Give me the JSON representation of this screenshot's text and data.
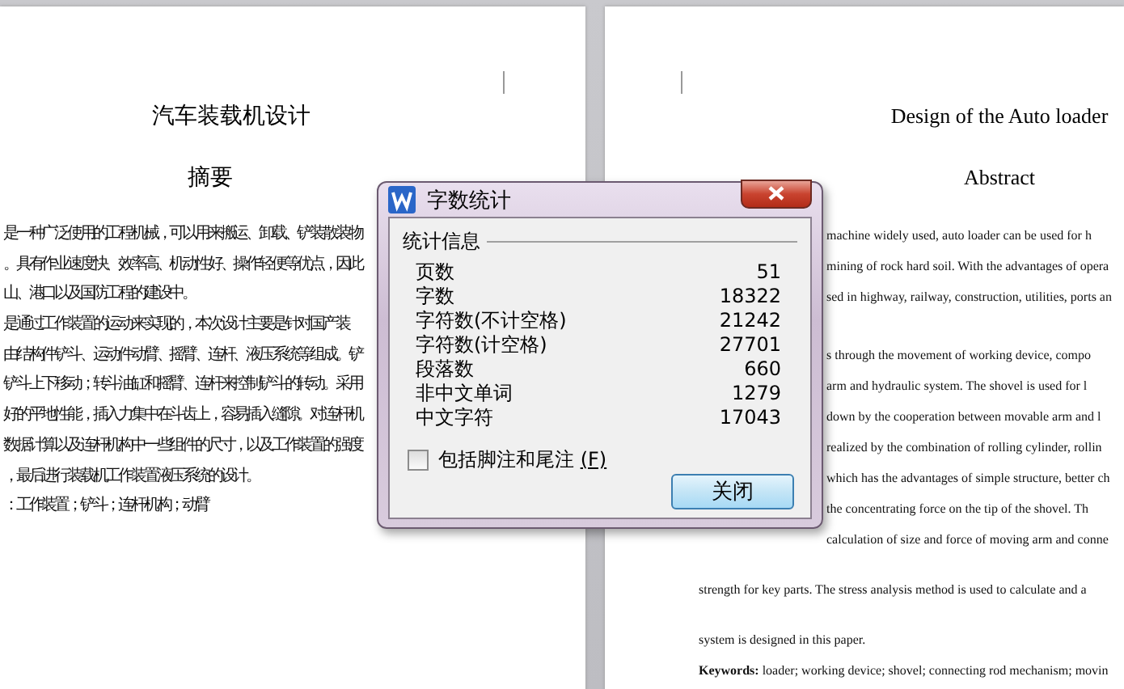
{
  "left_page": {
    "title": "汽车装载机设计",
    "heading": "摘要",
    "lines": [
      "是一种广泛使用的工程机械，可以用来搬运、卸载、铲装散装物",
      "。具有作业速度快、效率高、机动性好、操作轻便等优点，因此",
      "山、港口以及国防工程的建设中。",
      "是通过工作装置的运动来实现的，本次设计主要是针对国产装",
      "由结构件铲斗、运动件动臂、摇臂、连杆、液压系统等组成。铲",
      "铲斗上下移动；转斗油缸和摇臂、连杆来控制铲斗的转动。采用",
      "好的平地性能，插入力集中在斗齿上，容易插入缝隙。对连杆机",
      "数据计算以及连杆机构中一些组件的尺寸，以及工作装置的强度",
      "，最后进行装载机工作装置液压系统的设计。",
      "：工作装置；铲斗；连杆机构；动臂"
    ]
  },
  "right_page": {
    "title": "Design of the Auto loader",
    "heading": "Abstract",
    "paragraphs": [
      [
        "machine widely used, auto loader can be used for h",
        "mining of rock hard soil. With the advantages of opera",
        "sed in highway, railway, construction, utilities, ports an"
      ],
      [
        "s through the movement of working device, compo",
        "arm and hydraulic system. The shovel is used for l",
        "down by the cooperation between movable arm and l",
        "realized by the combination of rolling cylinder, rollin",
        "which has the advantages of simple structure, better ch",
        "the concentrating force on the tip of the shovel. Th",
        "calculation of size and force of moving arm and conne"
      ]
    ],
    "lines_below": [
      "strength for key parts. The stress analysis method is used to calculate and a",
      "system is designed in this paper."
    ],
    "keywords": "**Keywords:** loader; working device; shovel; connecting rod mechanism; movin"
  },
  "dialog": {
    "title": "字数统计",
    "group_label": "统计信息",
    "stats": [
      {
        "label": "页数",
        "value": "51"
      },
      {
        "label": "字数",
        "value": "18322"
      },
      {
        "label": "字符数(不计空格)",
        "value": "21242"
      },
      {
        "label": "字符数(计空格)",
        "value": "27701"
      },
      {
        "label": "段落数",
        "value": "660"
      },
      {
        "label": "非中文单词",
        "value": "1279"
      },
      {
        "label": "中文字符",
        "value": "17043"
      }
    ],
    "include_footnotes": {
      "label": "包括脚注和尾注",
      "accelerator": "(F)",
      "checked": false
    },
    "buttons": [
      "关闭"
    ]
  }
}
